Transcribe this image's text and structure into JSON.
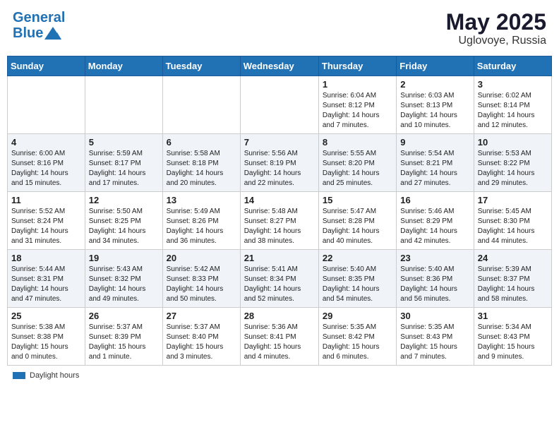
{
  "header": {
    "logo_line1": "General",
    "logo_line2": "Blue",
    "month_title": "May 2025",
    "subtitle": "Uglovoye, Russia"
  },
  "days_of_week": [
    "Sunday",
    "Monday",
    "Tuesday",
    "Wednesday",
    "Thursday",
    "Friday",
    "Saturday"
  ],
  "weeks": [
    [
      {
        "num": "",
        "info": ""
      },
      {
        "num": "",
        "info": ""
      },
      {
        "num": "",
        "info": ""
      },
      {
        "num": "",
        "info": ""
      },
      {
        "num": "1",
        "info": "Sunrise: 6:04 AM\nSunset: 8:12 PM\nDaylight: 14 hours\nand 7 minutes."
      },
      {
        "num": "2",
        "info": "Sunrise: 6:03 AM\nSunset: 8:13 PM\nDaylight: 14 hours\nand 10 minutes."
      },
      {
        "num": "3",
        "info": "Sunrise: 6:02 AM\nSunset: 8:14 PM\nDaylight: 14 hours\nand 12 minutes."
      }
    ],
    [
      {
        "num": "4",
        "info": "Sunrise: 6:00 AM\nSunset: 8:16 PM\nDaylight: 14 hours\nand 15 minutes."
      },
      {
        "num": "5",
        "info": "Sunrise: 5:59 AM\nSunset: 8:17 PM\nDaylight: 14 hours\nand 17 minutes."
      },
      {
        "num": "6",
        "info": "Sunrise: 5:58 AM\nSunset: 8:18 PM\nDaylight: 14 hours\nand 20 minutes."
      },
      {
        "num": "7",
        "info": "Sunrise: 5:56 AM\nSunset: 8:19 PM\nDaylight: 14 hours\nand 22 minutes."
      },
      {
        "num": "8",
        "info": "Sunrise: 5:55 AM\nSunset: 8:20 PM\nDaylight: 14 hours\nand 25 minutes."
      },
      {
        "num": "9",
        "info": "Sunrise: 5:54 AM\nSunset: 8:21 PM\nDaylight: 14 hours\nand 27 minutes."
      },
      {
        "num": "10",
        "info": "Sunrise: 5:53 AM\nSunset: 8:22 PM\nDaylight: 14 hours\nand 29 minutes."
      }
    ],
    [
      {
        "num": "11",
        "info": "Sunrise: 5:52 AM\nSunset: 8:24 PM\nDaylight: 14 hours\nand 31 minutes."
      },
      {
        "num": "12",
        "info": "Sunrise: 5:50 AM\nSunset: 8:25 PM\nDaylight: 14 hours\nand 34 minutes."
      },
      {
        "num": "13",
        "info": "Sunrise: 5:49 AM\nSunset: 8:26 PM\nDaylight: 14 hours\nand 36 minutes."
      },
      {
        "num": "14",
        "info": "Sunrise: 5:48 AM\nSunset: 8:27 PM\nDaylight: 14 hours\nand 38 minutes."
      },
      {
        "num": "15",
        "info": "Sunrise: 5:47 AM\nSunset: 8:28 PM\nDaylight: 14 hours\nand 40 minutes."
      },
      {
        "num": "16",
        "info": "Sunrise: 5:46 AM\nSunset: 8:29 PM\nDaylight: 14 hours\nand 42 minutes."
      },
      {
        "num": "17",
        "info": "Sunrise: 5:45 AM\nSunset: 8:30 PM\nDaylight: 14 hours\nand 44 minutes."
      }
    ],
    [
      {
        "num": "18",
        "info": "Sunrise: 5:44 AM\nSunset: 8:31 PM\nDaylight: 14 hours\nand 47 minutes."
      },
      {
        "num": "19",
        "info": "Sunrise: 5:43 AM\nSunset: 8:32 PM\nDaylight: 14 hours\nand 49 minutes."
      },
      {
        "num": "20",
        "info": "Sunrise: 5:42 AM\nSunset: 8:33 PM\nDaylight: 14 hours\nand 50 minutes."
      },
      {
        "num": "21",
        "info": "Sunrise: 5:41 AM\nSunset: 8:34 PM\nDaylight: 14 hours\nand 52 minutes."
      },
      {
        "num": "22",
        "info": "Sunrise: 5:40 AM\nSunset: 8:35 PM\nDaylight: 14 hours\nand 54 minutes."
      },
      {
        "num": "23",
        "info": "Sunrise: 5:40 AM\nSunset: 8:36 PM\nDaylight: 14 hours\nand 56 minutes."
      },
      {
        "num": "24",
        "info": "Sunrise: 5:39 AM\nSunset: 8:37 PM\nDaylight: 14 hours\nand 58 minutes."
      }
    ],
    [
      {
        "num": "25",
        "info": "Sunrise: 5:38 AM\nSunset: 8:38 PM\nDaylight: 15 hours\nand 0 minutes."
      },
      {
        "num": "26",
        "info": "Sunrise: 5:37 AM\nSunset: 8:39 PM\nDaylight: 15 hours\nand 1 minute."
      },
      {
        "num": "27",
        "info": "Sunrise: 5:37 AM\nSunset: 8:40 PM\nDaylight: 15 hours\nand 3 minutes."
      },
      {
        "num": "28",
        "info": "Sunrise: 5:36 AM\nSunset: 8:41 PM\nDaylight: 15 hours\nand 4 minutes."
      },
      {
        "num": "29",
        "info": "Sunrise: 5:35 AM\nSunset: 8:42 PM\nDaylight: 15 hours\nand 6 minutes."
      },
      {
        "num": "30",
        "info": "Sunrise: 5:35 AM\nSunset: 8:43 PM\nDaylight: 15 hours\nand 7 minutes."
      },
      {
        "num": "31",
        "info": "Sunrise: 5:34 AM\nSunset: 8:43 PM\nDaylight: 15 hours\nand 9 minutes."
      }
    ]
  ],
  "footer": {
    "daylight_label": "Daylight hours"
  }
}
